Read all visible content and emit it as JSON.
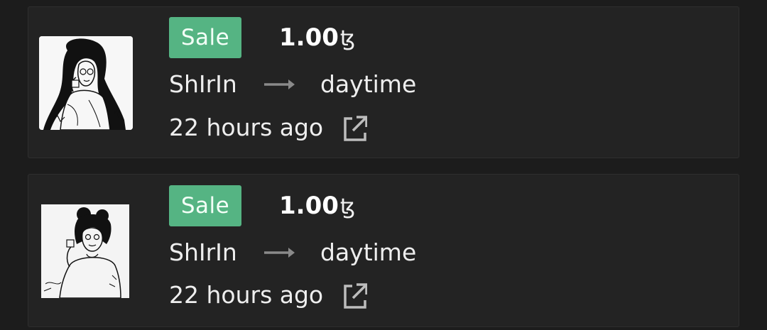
{
  "activity": [
    {
      "type_label": "Sale",
      "price": "1.00",
      "currency_symbol": "ꜩ",
      "from": "ShIrIn",
      "to": "daytime",
      "time": "22 hours ago",
      "icons": {
        "arrow": "arrow-right-icon",
        "link": "external-link-icon"
      }
    },
    {
      "type_label": "Sale",
      "price": "1.00",
      "currency_symbol": "ꜩ",
      "from": "ShIrIn",
      "to": "daytime",
      "time": "22 hours ago",
      "icons": {
        "arrow": "arrow-right-icon",
        "link": "external-link-icon"
      }
    }
  ],
  "colors": {
    "background": "#1c1c1c",
    "card": "#232323",
    "sale_badge": "#55b483",
    "arrow": "#8a8a8a",
    "link_icon": "#bdbdbd"
  }
}
